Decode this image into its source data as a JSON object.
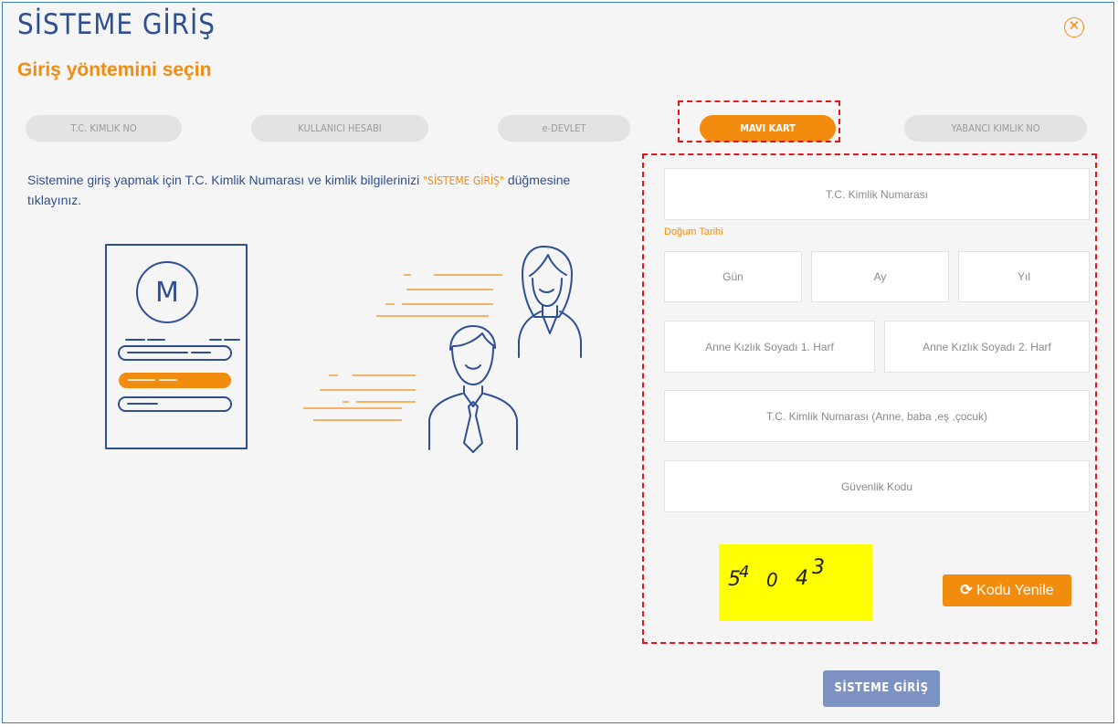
{
  "header": {
    "title": "SİSTEME GİRİŞ",
    "subtitle": "Giriş yöntemini seçin",
    "close_icon": "close-circle-icon"
  },
  "tabs": [
    {
      "label": "T.C. KIMLIK NO",
      "active": false
    },
    {
      "label": "KULLANICI HESABI",
      "active": false
    },
    {
      "label": "e-DEVLET",
      "active": false
    },
    {
      "label": "MAVI KART",
      "active": true
    },
    {
      "label": "YABANCI KIMLIK NO",
      "active": false
    }
  ],
  "description": {
    "before": "Sistemine giriş yapmak için T.C. Kimlik Numarası ve kimlik bilgilerinizi ",
    "highlight": "\"SİSTEME GİRİŞ\"",
    "after": " düğmesine tıklayınız."
  },
  "illustration": {
    "card_letter": "M"
  },
  "form": {
    "tc_placeholder": "T.C. Kimlik Numarası",
    "dob_label": "Doğum Tarihi",
    "day_placeholder": "Gün",
    "month_placeholder": "Ay",
    "year_placeholder": "Yıl",
    "mother_letter1_placeholder": "Anne Kızlık Soyadı 1. Harf",
    "mother_letter2_placeholder": "Anne Kızlık Soyadı 2. Harf",
    "relative_tc_placeholder": "T.C. Kimlik Numarası (Anne, baba ,eş ,çocuk)",
    "security_code_placeholder": "Güvenlik Kodu",
    "captcha_chars": [
      "5",
      "4",
      "0",
      "4",
      "3"
    ],
    "refresh_label": "Kodu Yenile",
    "refresh_icon": "refresh-icon"
  },
  "submit_label": "SİSTEME GİRİŞ",
  "colors": {
    "primary_blue": "#2f4f93",
    "accent_orange": "#f28c0f",
    "highlight_red": "#e8141c",
    "captcha_yellow": "#ffff00",
    "submit_blue": "#7b92c2"
  }
}
